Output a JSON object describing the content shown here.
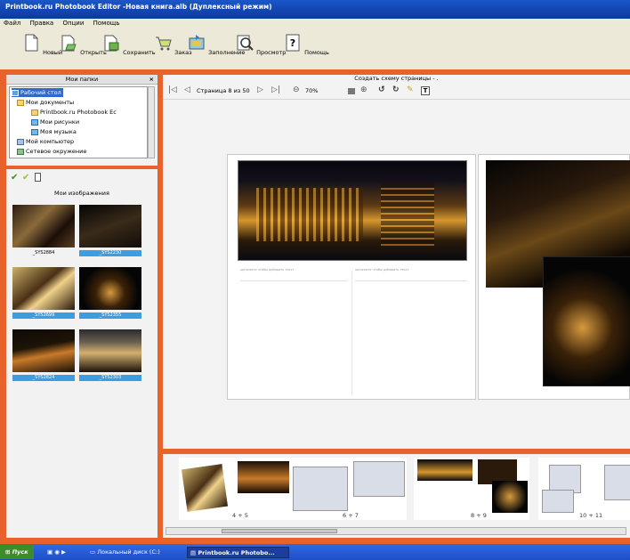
{
  "window": {
    "title": "Printbook.ru Photobook Editor -Новая книга.alb (Дуплексный режим)"
  },
  "menu": [
    "Файл",
    "Правка",
    "Опции",
    "Помощь"
  ],
  "toolbar": [
    {
      "label": "Новый",
      "icon": "new-document-icon"
    },
    {
      "label": "Открыть",
      "icon": "open-folder-icon"
    },
    {
      "label": "Сохранить",
      "icon": "save-icon"
    },
    {
      "label": "Заказ",
      "icon": "shopping-cart-icon"
    },
    {
      "label": "Заполнение",
      "icon": "autofill-icon"
    },
    {
      "label": "Просмотр",
      "icon": "preview-icon"
    },
    {
      "label": "Помощь",
      "icon": "help-icon"
    }
  ],
  "folders_panel": {
    "title": "Мои папки",
    "close": "×",
    "tree": [
      "Рабочий стол",
      "Мои документы",
      "Printbook.ru Photobook Ec",
      "Мои рисунки",
      "Моя музыка",
      "Мой компьютер",
      "Сетевое окружение"
    ]
  },
  "images_panel": {
    "title": "Мои изображения",
    "images": [
      {
        "label": "_SYS2884",
        "selected": false
      },
      {
        "label": "_SYS2230",
        "selected": true
      },
      {
        "label": "_SYS2699",
        "selected": true
      },
      {
        "label": "_SYS2355",
        "selected": true
      },
      {
        "label": "_SYS2824",
        "selected": true
      },
      {
        "label": "_SYS2303",
        "selected": true
      }
    ]
  },
  "editor": {
    "schema_link": "Создать схему страницы - .",
    "page_indicator": "Страница 8 из 50",
    "zoom": "70%",
    "caption_placeholder": "щелкните чтобы добавить текст"
  },
  "strip": {
    "labels": [
      "4 + 5",
      "6 + 7",
      "8 + 9",
      "10 + 11"
    ]
  },
  "taskbar": {
    "start": "Пуск",
    "drive": "Локальный диск (C:)",
    "app": "Printbook.ru Photobo..."
  },
  "colors": {
    "accent": "#e8622b",
    "selection": "#3e9de0",
    "titlebar": "#0b3a9e"
  }
}
